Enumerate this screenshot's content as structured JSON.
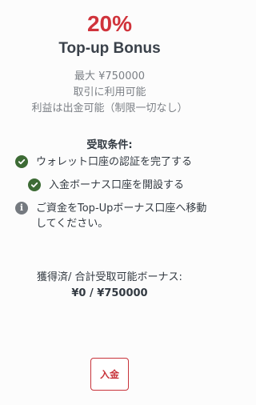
{
  "bonus": {
    "percent": "20%",
    "title": "Top-up Bonus",
    "details": [
      "最大 ¥750000",
      "取引に利用可能",
      "利益は出金可能（制限一切なし）"
    ]
  },
  "conditions": {
    "heading": "受取条件:",
    "items": [
      {
        "text": "ウォレット口座の認証を完了する",
        "icon": "check-circle-icon",
        "status": "done"
      },
      {
        "text": "入金ボーナス口座を開設する",
        "icon": "check-circle-icon",
        "status": "done"
      },
      {
        "text": "ご資金をTop-Upボーナス口座へ移動してください。",
        "icon": "info-circle-icon",
        "status": "pending"
      }
    ]
  },
  "progress": {
    "label": "獲得済/ 合計受取可能ボーナス:",
    "value": "¥0 / ¥750000"
  },
  "actions": {
    "deposit_label": "入金"
  },
  "colors": {
    "accent": "#d0333b",
    "check": "#3d6b35",
    "info": "#757a80"
  }
}
